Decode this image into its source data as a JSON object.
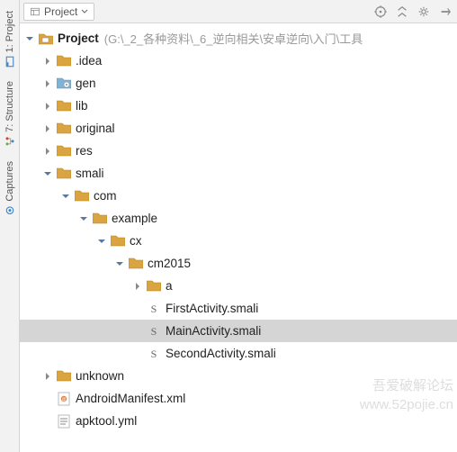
{
  "leftTabs": {
    "project": "1: Project",
    "structure": "7: Structure",
    "captures": "Captures"
  },
  "toolbar": {
    "panelLabel": "Project"
  },
  "root": {
    "label": "Project",
    "pathHint": "(G:\\_2_各种资料\\_6_逆向相关\\安卓逆向\\入门\\工具"
  },
  "tree": {
    "idea": ".idea",
    "gen": "gen",
    "lib": "lib",
    "original": "original",
    "res": "res",
    "smali": "smali",
    "com": "com",
    "example": "example",
    "cx": "cx",
    "cm2015": "cm2015",
    "a": "a",
    "first": "FirstActivity.smali",
    "main": "MainActivity.smali",
    "second": "SecondActivity.smali",
    "unknown": "unknown",
    "manifest": "AndroidManifest.xml",
    "apktool": "apktool.yml"
  },
  "watermark": {
    "line1": "吾爱破解论坛",
    "line2": "www.52pojie.cn"
  }
}
